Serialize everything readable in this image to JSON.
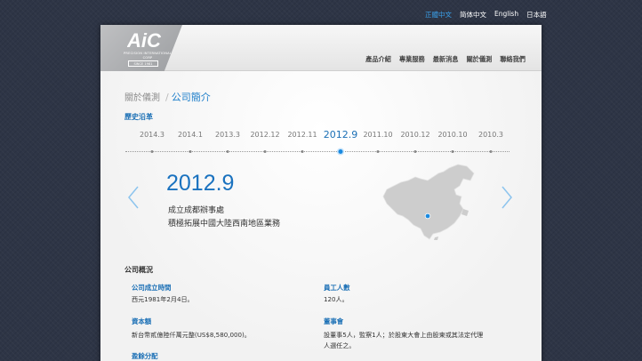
{
  "languages": [
    {
      "label": "正體中文",
      "active": true
    },
    {
      "label": "简体中文",
      "active": false
    },
    {
      "label": "English",
      "active": false
    },
    {
      "label": "日本語",
      "active": false
    }
  ],
  "logo": {
    "mark": "AiC",
    "subtitle": "PRECISION INTERNATIONAL CORP",
    "established": "SINCE 1981"
  },
  "nav": {
    "items": [
      "產品介紹",
      "專業服務",
      "最新消息",
      "關於儀測",
      "聯絡我們"
    ]
  },
  "breadcrumb": {
    "parent": "關於儀測",
    "separator": "/",
    "current": "公司簡介"
  },
  "history": {
    "title": "歷史沿革",
    "years": [
      "2014.3",
      "2014.1",
      "2013.3",
      "2012.12",
      "2012.11",
      "2012.9",
      "2011.10",
      "2010.12",
      "2010.10",
      "2010.3"
    ],
    "active_index": 5,
    "selected_year": "2012.9",
    "event_lines": [
      "成立成都辦事處",
      "積極拓展中國大陸西南地區業務"
    ]
  },
  "overview": {
    "title": "公司概況",
    "fields": {
      "founded_label": "公司成立時間",
      "founded_value": "西元1981年2月4日。",
      "employees_label": "員工人數",
      "employees_value": "120人。",
      "capital_label": "資本額",
      "capital_value": "新台幣貳億陸仟萬元整(US$8,580,000)。",
      "board_label": "董事會",
      "board_value_1": "設董事5人，監察1人；於股東大會上由股東或其法定代理",
      "board_value_2": "人選任之。",
      "dividend_label": "盈餘分配"
    }
  },
  "colors": {
    "accent": "#1a72bf",
    "active_lang": "#3aa0ea",
    "background": "#2e3546"
  }
}
